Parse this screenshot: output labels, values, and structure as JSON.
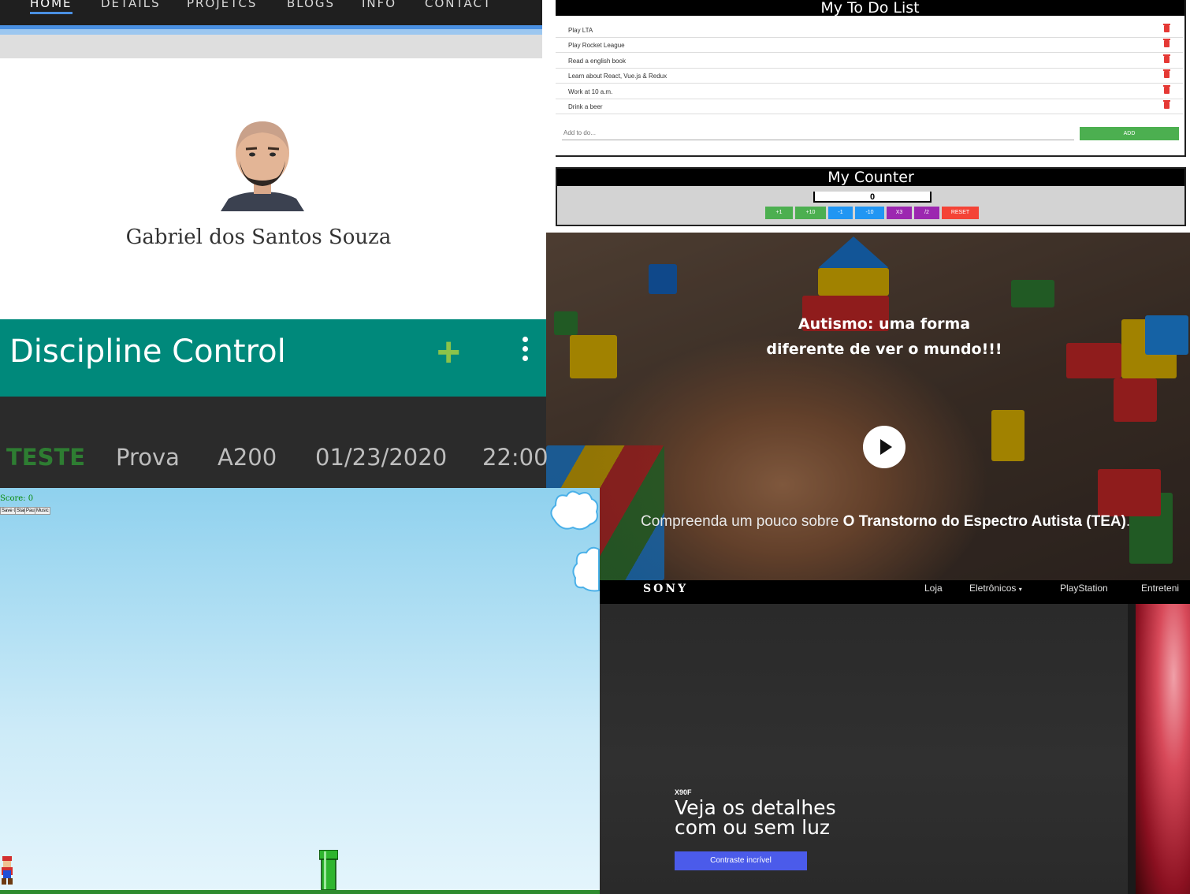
{
  "portfolio": {
    "nav": [
      "HOME",
      "DETAILS",
      "PROJETCS",
      "BLOGS",
      "INFO",
      "CONTACT"
    ],
    "name": "Gabriel dos Santos Souza",
    "accent": "#4a90e2"
  },
  "todo": {
    "title": "My To Do List",
    "items": [
      "Play LTA",
      "Play Rocket League",
      "Read a english book",
      "Learn about React, Vue.js & Redux",
      "Work at 10 a.m.",
      "Drink a beer"
    ],
    "input_placeholder": "Add to do...",
    "add_label": "ADD"
  },
  "counter": {
    "title": "My Counter",
    "value": "0",
    "buttons": [
      {
        "label": "+1",
        "color": "#4caf50"
      },
      {
        "label": "+10",
        "color": "#4caf50"
      },
      {
        "label": "-1",
        "color": "#2196f3"
      },
      {
        "label": "-10",
        "color": "#2196f3"
      },
      {
        "label": "X3",
        "color": "#9c27b0"
      },
      {
        "label": "/2",
        "color": "#9c27b0"
      },
      {
        "label": "RESET",
        "color": "#f44336"
      }
    ]
  },
  "autism": {
    "headline_line1": "Autismo: uma forma",
    "headline_line2": "diferente de ver o mundo!!!",
    "sub_prefix": "Compreenda um pouco sobre ",
    "sub_bold": "O Transtorno do Espectro Autista (TEA)",
    "sub_suffix": "."
  },
  "discipline": {
    "title": "Discipline Control",
    "row": [
      "TESTE",
      "Prova",
      "A200",
      "01/23/2020",
      "22:00"
    ],
    "appbar_color": "#00897b",
    "highlight_color": "#2e7d32"
  },
  "game": {
    "score": "Score: 0",
    "controls": [
      "Save Game",
      "Start",
      "Pause",
      "Music"
    ]
  },
  "sony": {
    "logo": "SONY",
    "nav": [
      "Loja",
      "Eletrônicos",
      "PlayStation",
      "Entreteni"
    ],
    "model": "X90F",
    "headline_line1": "Veja os detalhes",
    "headline_line2": "com ou sem luz",
    "cta": "Contraste incrível"
  }
}
